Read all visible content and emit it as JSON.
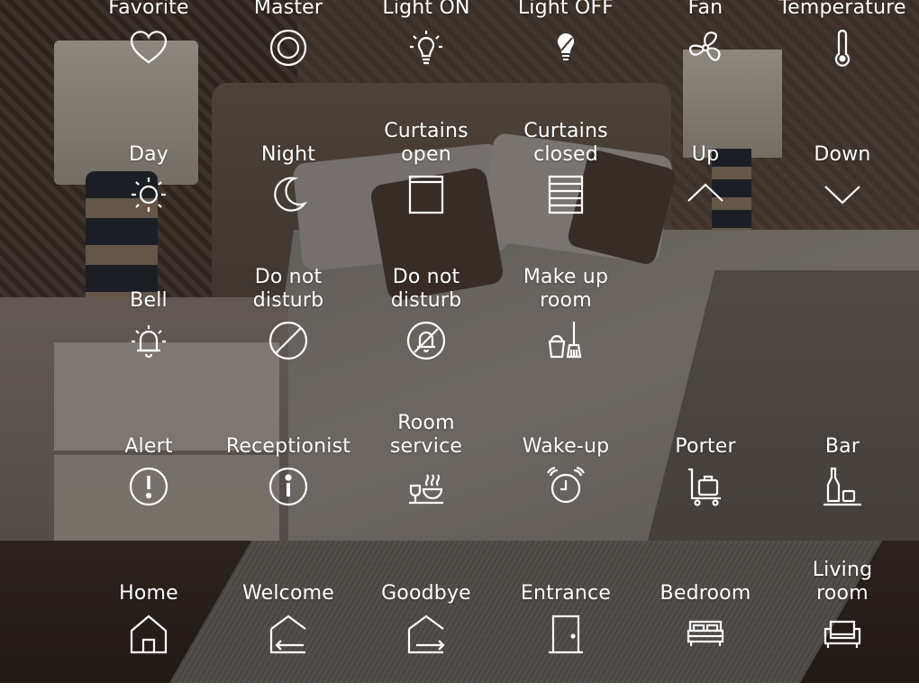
{
  "background": {
    "description": "",
    "overlay_color": "#1a1714"
  },
  "buttons": [
    {
      "id": "favorite",
      "label": "Favorite",
      "icon": "heart-icon"
    },
    {
      "id": "master",
      "label": "Master",
      "icon": "ring-icon"
    },
    {
      "id": "light-on",
      "label": "Light ON",
      "icon": "bulb-on-icon"
    },
    {
      "id": "light-off",
      "label": "Light OFF",
      "icon": "bulb-off-icon"
    },
    {
      "id": "fan",
      "label": "Fan",
      "icon": "fan-icon"
    },
    {
      "id": "temperature",
      "label": "Temperature",
      "icon": "thermometer-icon"
    },
    {
      "id": "day",
      "label": "Day",
      "icon": "sun-icon"
    },
    {
      "id": "night",
      "label": "Night",
      "icon": "moon-icon"
    },
    {
      "id": "curtains-open",
      "label": "Curtains\nopen",
      "icon": "curtains-open-icon"
    },
    {
      "id": "curtains-closed",
      "label": "Curtains\nclosed",
      "icon": "curtains-closed-icon"
    },
    {
      "id": "up",
      "label": "Up",
      "icon": "chevron-up-icon"
    },
    {
      "id": "down",
      "label": "Down",
      "icon": "chevron-down-icon"
    },
    {
      "id": "bell",
      "label": "Bell",
      "icon": "bell-ringing-icon"
    },
    {
      "id": "do-not-disturb-1",
      "label": "Do not\ndisturb",
      "icon": "prohibited-icon"
    },
    {
      "id": "do-not-disturb-2",
      "label": "Do not\ndisturb",
      "icon": "bell-off-icon"
    },
    {
      "id": "make-up-room",
      "label": "Make up\nroom",
      "icon": "bucket-broom-icon"
    },
    {
      "id": "alert",
      "label": "Alert",
      "icon": "exclamation-icon"
    },
    {
      "id": "receptionist",
      "label": "Receptionist",
      "icon": "info-icon"
    },
    {
      "id": "room-service",
      "label": "Room\nservice",
      "icon": "room-service-icon"
    },
    {
      "id": "wake-up",
      "label": "Wake-up",
      "icon": "alarm-clock-icon"
    },
    {
      "id": "porter",
      "label": "Porter",
      "icon": "luggage-cart-icon"
    },
    {
      "id": "bar",
      "label": "Bar",
      "icon": "bottle-glass-icon"
    },
    {
      "id": "home",
      "label": "Home",
      "icon": "house-icon"
    },
    {
      "id": "welcome",
      "label": "Welcome",
      "icon": "house-enter-icon"
    },
    {
      "id": "goodbye",
      "label": "Goodbye",
      "icon": "house-exit-icon"
    },
    {
      "id": "entrance",
      "label": "Entrance",
      "icon": "door-icon"
    },
    {
      "id": "bedroom",
      "label": "Bedroom",
      "icon": "bed-icon"
    },
    {
      "id": "living-room",
      "label": "Living\nroom",
      "icon": "sofa-icon"
    }
  ]
}
